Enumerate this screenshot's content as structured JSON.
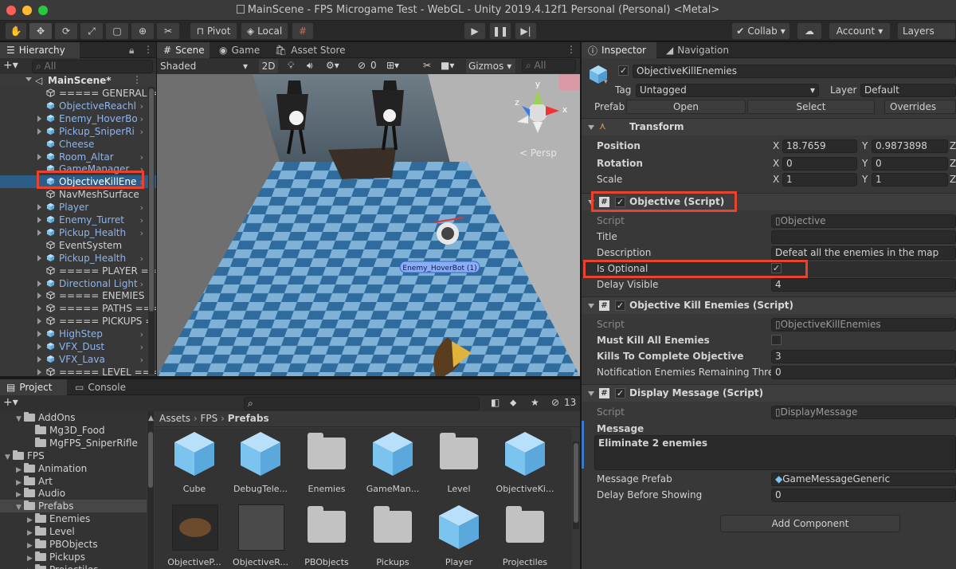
{
  "window": {
    "title": "MainScene - FPS Microgame Test - WebGL - Unity 2019.4.12f1 Personal (Personal) <Metal>"
  },
  "colors": {
    "accent_red": "#e8432f",
    "selection": "#2c5d87",
    "cube_blue": "#7cc4f0",
    "close": "#fe5f57",
    "minimize": "#febb2e",
    "maximize": "#28c840"
  },
  "toolbar": {
    "tools": [
      "hand-icon",
      "move-icon",
      "rotate-icon",
      "scale-icon",
      "rect-icon",
      "transform-icon",
      "custom-tool-icon"
    ],
    "pivot": "Pivot",
    "local": "Local",
    "collab": "Collab",
    "account": "Account",
    "layers": "Layers"
  },
  "hierarchy": {
    "tab": "Hierarchy",
    "search_placeholder": "All",
    "scene": "MainScene*",
    "items": [
      {
        "label": "===== GENERAL =",
        "type": "plain",
        "arrow": false,
        "chev": false
      },
      {
        "label": "ObjectiveReachl",
        "type": "prefab",
        "arrow": false,
        "chev": true
      },
      {
        "label": "Enemy_HoverBo",
        "type": "prefab",
        "arrow": true,
        "chev": true
      },
      {
        "label": "Pickup_SniperRi",
        "type": "prefab",
        "arrow": true,
        "chev": true
      },
      {
        "label": "Cheese",
        "type": "prefab",
        "arrow": false,
        "chev": false
      },
      {
        "label": "Room_Altar",
        "type": "prefab",
        "arrow": true,
        "chev": true
      },
      {
        "label": "GameManager",
        "type": "prefab",
        "arrow": false,
        "chev": true
      },
      {
        "label": "ObjectiveKillEne",
        "type": "selected",
        "arrow": false,
        "chev": true
      },
      {
        "label": "NavMeshSurface",
        "type": "plain",
        "arrow": false,
        "chev": false
      },
      {
        "label": "Player",
        "type": "prefab",
        "arrow": true,
        "chev": true
      },
      {
        "label": "Enemy_Turret",
        "type": "prefab",
        "arrow": true,
        "chev": true
      },
      {
        "label": "Pickup_Health",
        "type": "prefab",
        "arrow": true,
        "chev": true
      },
      {
        "label": "EventSystem",
        "type": "plain",
        "arrow": false,
        "chev": false
      },
      {
        "label": "Pickup_Health",
        "type": "prefab",
        "arrow": true,
        "chev": true
      },
      {
        "label": "===== PLAYER ==",
        "type": "plain",
        "arrow": false,
        "chev": false
      },
      {
        "label": "Directional Light",
        "type": "prefab",
        "arrow": true,
        "chev": true
      },
      {
        "label": "===== ENEMIES",
        "type": "plain",
        "arrow": true,
        "chev": false
      },
      {
        "label": "===== PATHS ===",
        "type": "plain",
        "arrow": true,
        "chev": false
      },
      {
        "label": "===== PICKUPS =",
        "type": "plain",
        "arrow": true,
        "chev": false
      },
      {
        "label": "HighStep",
        "type": "prefab",
        "arrow": true,
        "chev": true
      },
      {
        "label": "VFX_Dust",
        "type": "prefab",
        "arrow": true,
        "chev": true
      },
      {
        "label": "VFX_Lava",
        "type": "prefab",
        "arrow": true,
        "chev": true
      },
      {
        "label": "===== LEVEL ====",
        "type": "plain",
        "arrow": true,
        "chev": false
      }
    ]
  },
  "scene": {
    "tabs": [
      "Scene",
      "Game",
      "Asset Store"
    ],
    "shading": "Shaded",
    "mode_2d": "2D",
    "hidden_count": "0",
    "gizmos": "Gizmos",
    "search_placeholder": "All",
    "persp": "< Persp",
    "axis_y": "y",
    "axis_x": "x",
    "axis_z": "z",
    "enemy_label": "Enemy_HoverBot (1)"
  },
  "inspector": {
    "tabs": [
      "Inspector",
      "Navigation"
    ],
    "object_name": "ObjectiveKillEnemies",
    "tag_label": "Tag",
    "tag": "Untagged",
    "layer_label": "Layer",
    "layer": "Default",
    "prefab_label": "Prefab",
    "open": "Open",
    "select": "Select",
    "overrides": "Overrides",
    "transform": {
      "title": "Transform",
      "position_label": "Position",
      "rotation_label": "Rotation",
      "scale_label": "Scale",
      "x_label": "X",
      "y_label": "Y",
      "z_label": "Z",
      "position": {
        "x": "18.7659",
        "y": "0.9873898"
      },
      "rotation": {
        "x": "0",
        "y": "0"
      },
      "scale": {
        "x": "1",
        "y": "1"
      }
    },
    "objective": {
      "title": "Objective (Script)",
      "script_label": "Script",
      "script": "Objective",
      "title_label": "Title",
      "title_value": "",
      "description_label": "Description",
      "description": "Defeat all the enemies in the map",
      "optional_label": "Is Optional",
      "delay_label": "Delay Visible",
      "delay": "4"
    },
    "kill": {
      "title": "Objective Kill Enemies (Script)",
      "script_label": "Script",
      "script": "ObjectiveKillEnemies",
      "must_kill_label": "Must Kill All Enemies",
      "kills_label": "Kills To Complete Objective",
      "kills": "3",
      "notify_label": "Notification Enemies Remaining Thresh",
      "notify": "0"
    },
    "display": {
      "title": "Display Message (Script)",
      "script_label": "Script",
      "script": "DisplayMessage",
      "message_label": "Message",
      "message": "Eliminate 2 enemies",
      "prefab_label": "Message Prefab",
      "prefab": "GameMessageGeneric",
      "delay_label": "Delay Before Showing",
      "delay": "0"
    },
    "add_component": "Add Component"
  },
  "project": {
    "tabs": [
      "Project",
      "Console"
    ],
    "hidden_count": "13",
    "breadcrumb": [
      "Assets",
      "FPS",
      "Prefabs"
    ],
    "tree": [
      {
        "label": "AddOns",
        "indent": 1,
        "open": true
      },
      {
        "label": "Mg3D_Food",
        "indent": 2,
        "open": false,
        "noarrow": true
      },
      {
        "label": "MgFPS_SniperRifle",
        "indent": 2,
        "open": false,
        "noarrow": true
      },
      {
        "label": "FPS",
        "indent": 0,
        "open": true
      },
      {
        "label": "Animation",
        "indent": 1,
        "open": false
      },
      {
        "label": "Art",
        "indent": 1,
        "open": false
      },
      {
        "label": "Audio",
        "indent": 1,
        "open": false
      },
      {
        "label": "Prefabs",
        "indent": 1,
        "open": true,
        "selected": true
      },
      {
        "label": "Enemies",
        "indent": 2,
        "open": false
      },
      {
        "label": "Level",
        "indent": 2,
        "open": false
      },
      {
        "label": "PBObjects",
        "indent": 2,
        "open": false
      },
      {
        "label": "Pickups",
        "indent": 2,
        "open": false
      },
      {
        "label": "Projectiles",
        "indent": 2,
        "open": false
      }
    ],
    "assets": [
      {
        "name": "Cube",
        "kind": "cube"
      },
      {
        "name": "DebugTele...",
        "kind": "cube"
      },
      {
        "name": "Enemies",
        "kind": "folder"
      },
      {
        "name": "GameMan...",
        "kind": "cube"
      },
      {
        "name": "Level",
        "kind": "folder"
      },
      {
        "name": "ObjectiveKi...",
        "kind": "cube"
      },
      {
        "name": "ObjectiveP...",
        "kind": "cookie"
      },
      {
        "name": "ObjectiveR...",
        "kind": "dark"
      },
      {
        "name": "PBObjects",
        "kind": "folder"
      },
      {
        "name": "Pickups",
        "kind": "folder"
      },
      {
        "name": "Player",
        "kind": "cube"
      },
      {
        "name": "Projectiles",
        "kind": "folder"
      }
    ]
  }
}
